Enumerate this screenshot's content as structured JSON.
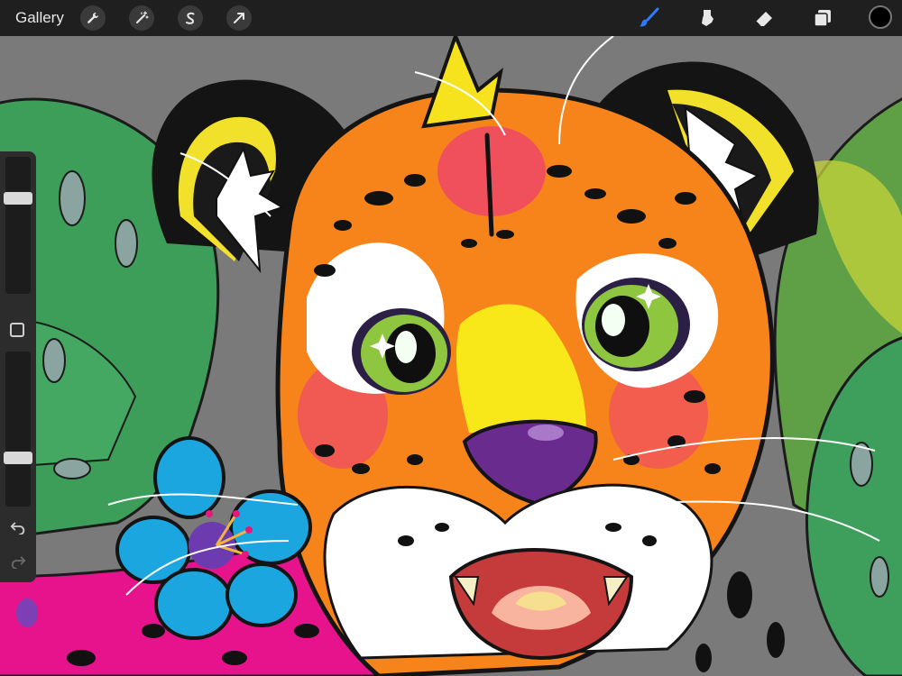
{
  "topbar": {
    "gallery_label": "Gallery",
    "actions": [
      {
        "name": "actions-wrench-icon"
      },
      {
        "name": "adjustments-wand-icon"
      },
      {
        "name": "selection-s-icon"
      },
      {
        "name": "transform-arrow-icon"
      }
    ],
    "tools": {
      "active": "brush",
      "items": [
        "brush",
        "smudge",
        "eraser",
        "layers"
      ]
    },
    "current_color": "#000000"
  },
  "sidebar": {
    "brush_size_level": 0.72,
    "opacity_level": 0.3,
    "undo_icon": "undo-arrow-icon",
    "redo_icon": "redo-arrow-icon"
  },
  "colors": {
    "accent": "#2f7bff",
    "toolbar": "#1f1f1f",
    "canvas_bg": "#7a7a7a"
  }
}
